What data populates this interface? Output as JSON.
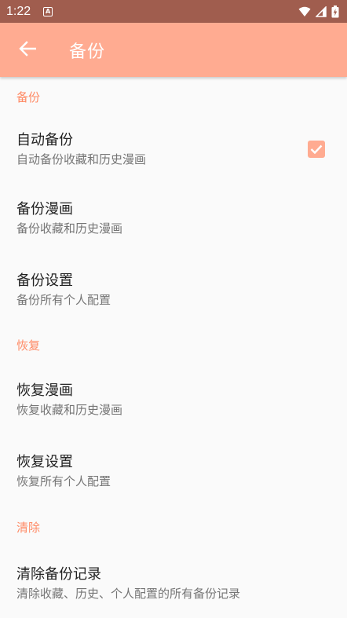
{
  "status_bar": {
    "time": "1:22",
    "notification_icon": "A"
  },
  "app_bar": {
    "title": "备份"
  },
  "sections": [
    {
      "header": "备份",
      "items": [
        {
          "title": "自动备份",
          "summary": "自动备份收藏和历史漫画",
          "checked": true
        },
        {
          "title": "备份漫画",
          "summary": "备份收藏和历史漫画"
        },
        {
          "title": "备份设置",
          "summary": "备份所有个人配置"
        }
      ]
    },
    {
      "header": "恢复",
      "items": [
        {
          "title": "恢复漫画",
          "summary": "恢复收藏和历史漫画"
        },
        {
          "title": "恢复设置",
          "summary": "恢复所有个人配置"
        }
      ]
    },
    {
      "header": "清除",
      "items": [
        {
          "title": "清除备份记录",
          "summary": "清除收藏、历史、个人配置的所有备份记录"
        }
      ]
    }
  ],
  "colors": {
    "status_bar": "#a05d4e",
    "app_bar": "#ffab91",
    "accent": "#ff8a65"
  }
}
